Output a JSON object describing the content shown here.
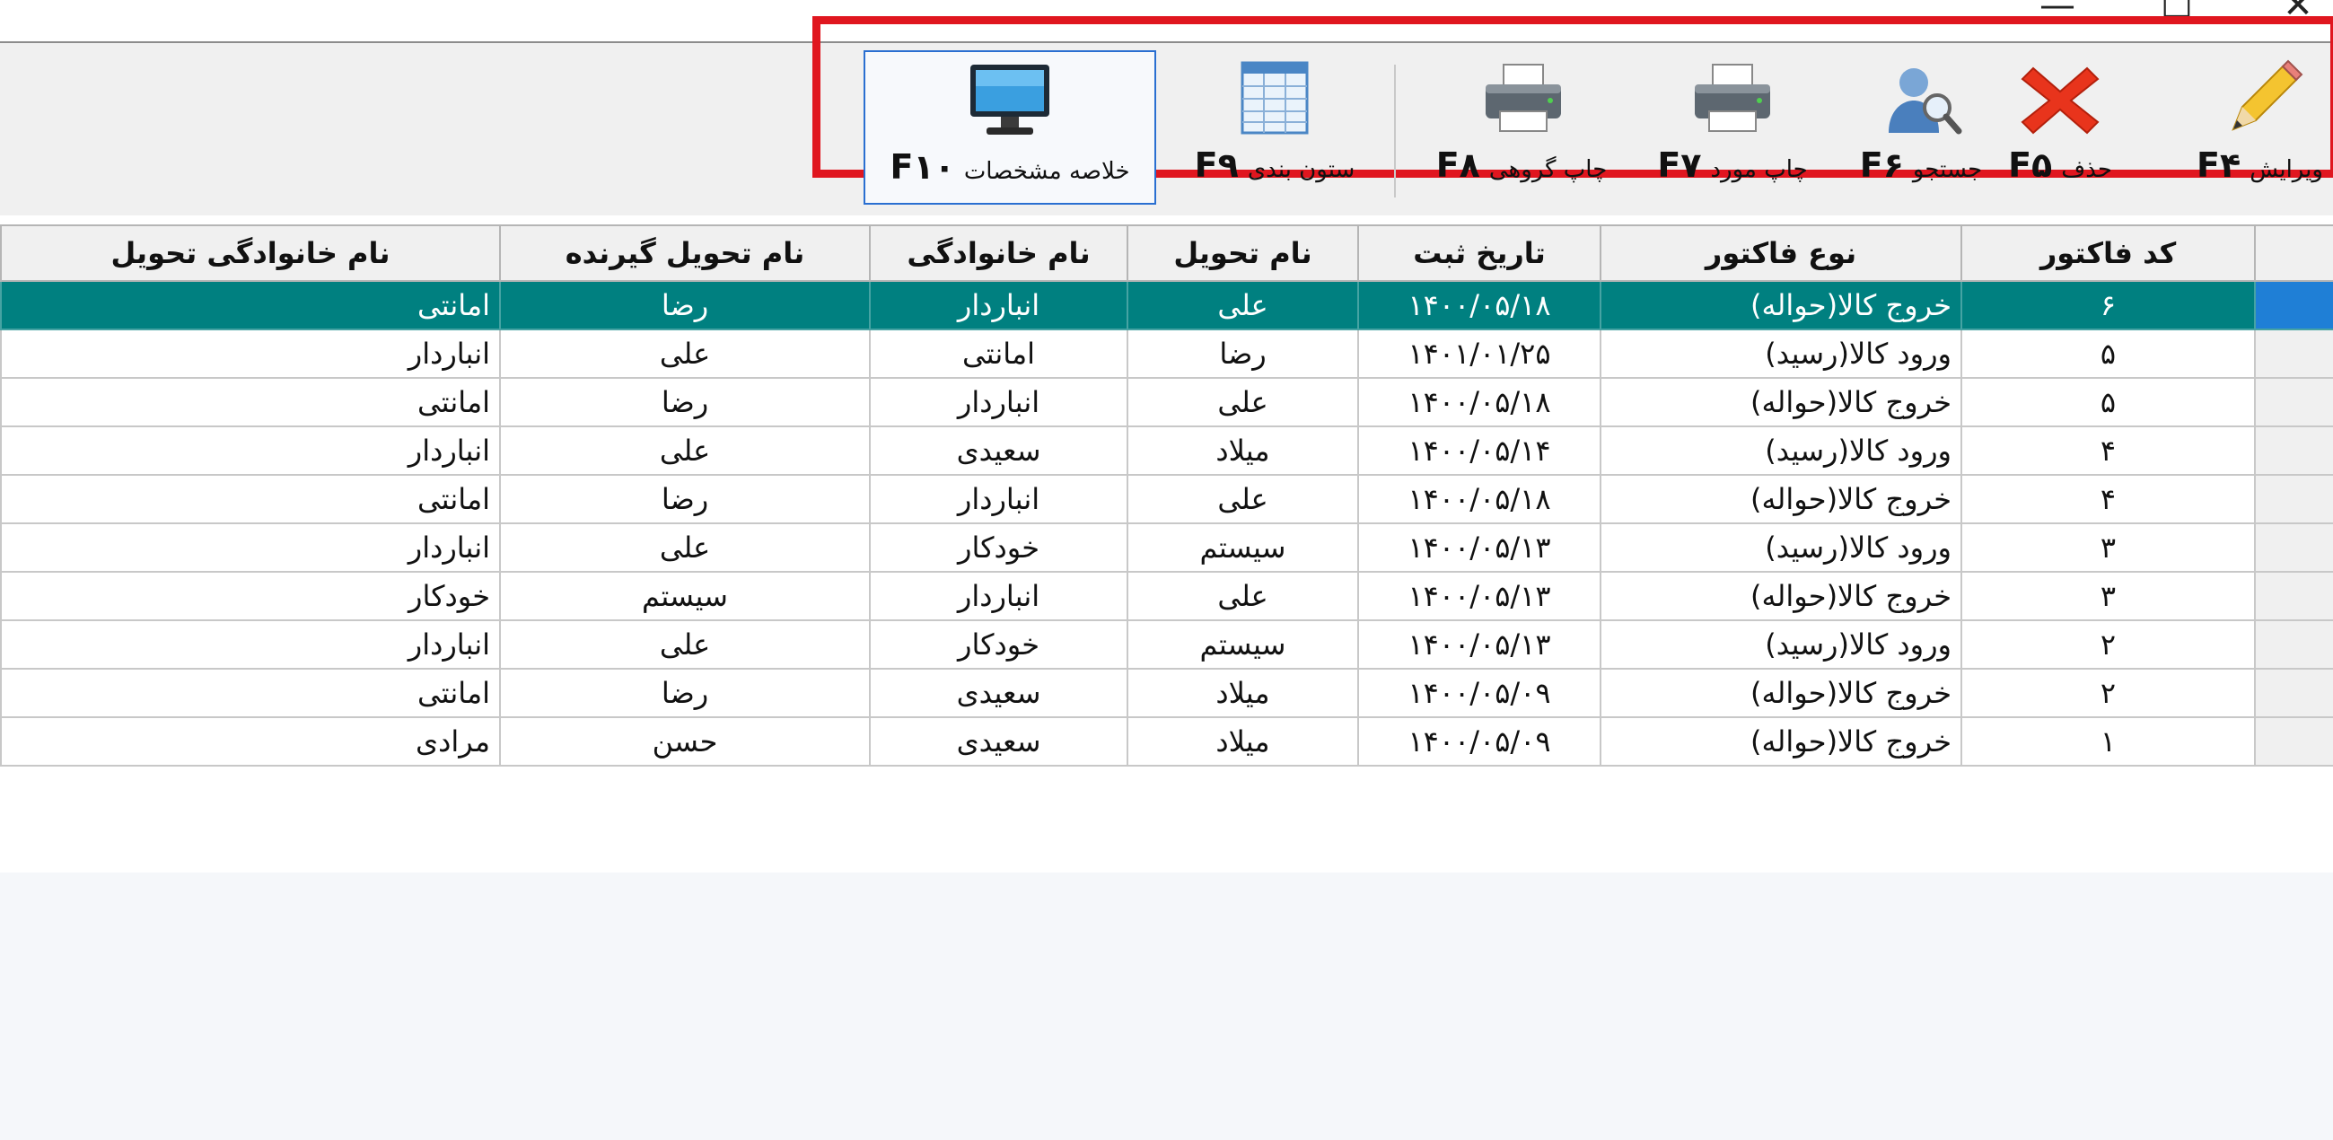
{
  "window": {
    "minimize": "—",
    "maximize": "☐",
    "close": "✕"
  },
  "toolbar": {
    "buttons": [
      {
        "label": "ویرایش",
        "key": "F۴",
        "icon": "pencil-icon"
      },
      {
        "label": "حذف",
        "key": "F۵",
        "icon": "delete-x-icon"
      },
      {
        "label": "جستجو",
        "key": "F۶",
        "icon": "search-user-icon"
      },
      {
        "label": "چاپ مورد",
        "key": "F۷",
        "icon": "printer-icon"
      },
      {
        "label": "چاپ گروهی",
        "key": "F۸",
        "icon": "printer-icon"
      },
      {
        "label": "ستون بندی",
        "key": "F۹",
        "icon": "table-columns-icon"
      },
      {
        "label": "خلاصه مشخصات",
        "key": "F۱۰",
        "icon": "monitor-icon"
      }
    ],
    "highlight_color": "#e0161f"
  },
  "table": {
    "columns": [
      "کد فاکتور",
      "نوع فاکتور",
      "تاریخ ثبت",
      "نام تحویل",
      "نام خانوادگی",
      "نام تحویل گیرنده",
      "نام خانوادگی تحویل"
    ],
    "rows": [
      [
        "۶",
        "خروج کالا(حواله)",
        "۱۴۰۰/۰۵/۱۸",
        "علی",
        "انباردار",
        "رضا",
        "امانتی"
      ],
      [
        "۵",
        "ورود کالا(رسید)",
        "۱۴۰۱/۰۱/۲۵",
        "رضا",
        "امانتی",
        "علی",
        "انباردار"
      ],
      [
        "۵",
        "خروج کالا(حواله)",
        "۱۴۰۰/۰۵/۱۸",
        "علی",
        "انباردار",
        "رضا",
        "امانتی"
      ],
      [
        "۴",
        "ورود کالا(رسید)",
        "۱۴۰۰/۰۵/۱۴",
        "میلاد",
        "سعیدی",
        "علی",
        "انباردار"
      ],
      [
        "۴",
        "خروج کالا(حواله)",
        "۱۴۰۰/۰۵/۱۸",
        "علی",
        "انباردار",
        "رضا",
        "امانتی"
      ],
      [
        "۳",
        "ورود کالا(رسید)",
        "۱۴۰۰/۰۵/۱۳",
        "سیستم",
        "خودکار",
        "علی",
        "انباردار"
      ],
      [
        "۳",
        "خروج کالا(حواله)",
        "۱۴۰۰/۰۵/۱۳",
        "علی",
        "انباردار",
        "سیستم",
        "خودکار"
      ],
      [
        "۲",
        "ورود کالا(رسید)",
        "۱۴۰۰/۰۵/۱۳",
        "سیستم",
        "خودکار",
        "علی",
        "انباردار"
      ],
      [
        "۲",
        "خروج کالا(حواله)",
        "۱۴۰۰/۰۵/۰۹",
        "میلاد",
        "سعیدی",
        "رضا",
        "امانتی"
      ],
      [
        "۱",
        "خروج کالا(حواله)",
        "۱۴۰۰/۰۵/۰۹",
        "میلاد",
        "سعیدی",
        "حسن",
        "مرادی"
      ]
    ],
    "selected_row": 0,
    "selected_color": "#008080"
  }
}
